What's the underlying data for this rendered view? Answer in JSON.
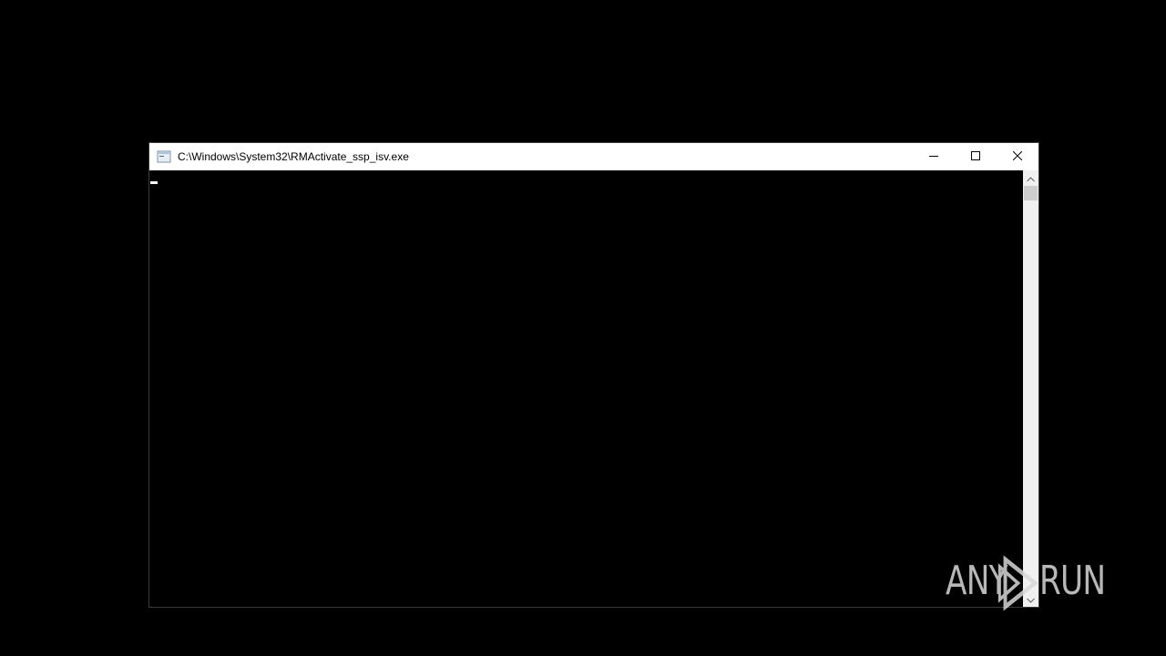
{
  "window": {
    "title": "C:\\Windows\\System32\\RMActivate_ssp_isv.exe",
    "icon": "console-app-icon",
    "buttons": {
      "minimize": "minimize-icon",
      "maximize": "maximize-icon",
      "close": "close-icon"
    }
  },
  "console": {
    "text": ""
  },
  "scrollbar": {
    "up_icon": "chevron-up-icon",
    "down_icon": "chevron-down-icon"
  },
  "watermark": {
    "left_text": "ANY",
    "right_text": "RUN"
  }
}
